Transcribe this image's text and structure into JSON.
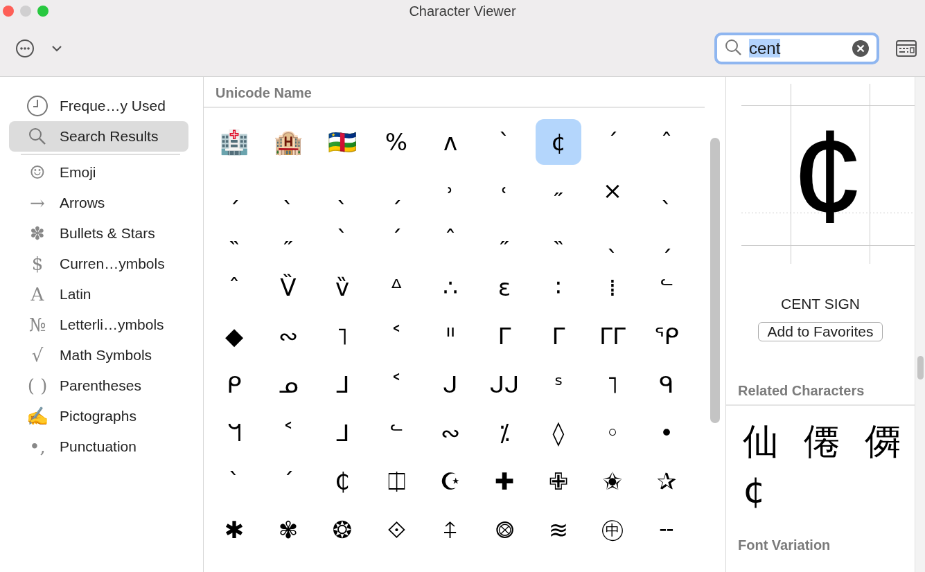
{
  "window": {
    "title": "Character Viewer"
  },
  "search": {
    "value": "cent"
  },
  "sidebar": {
    "items": [
      {
        "label": "Freque…y Used",
        "kind": "clock",
        "selected": false
      },
      {
        "label": "Search Results",
        "kind": "search",
        "selected": true
      },
      {
        "label": "Emoji",
        "kind": "glyph",
        "glyph": "☺",
        "selected": false
      },
      {
        "label": "Arrows",
        "kind": "glyph",
        "glyph": "→",
        "selected": false
      },
      {
        "label": "Bullets & Stars",
        "kind": "glyph",
        "glyph": "✽",
        "selected": false
      },
      {
        "label": "Curren…ymbols",
        "kind": "glyph",
        "glyph": "$",
        "selected": false
      },
      {
        "label": "Latin",
        "kind": "glyph",
        "glyph": "A",
        "selected": false
      },
      {
        "label": "Letterli…ymbols",
        "kind": "glyph",
        "glyph": "№",
        "selected": false
      },
      {
        "label": "Math Symbols",
        "kind": "glyph",
        "glyph": "√",
        "selected": false
      },
      {
        "label": "Parentheses",
        "kind": "glyph",
        "glyph": "( )",
        "selected": false
      },
      {
        "label": "Pictographs",
        "kind": "glyph",
        "glyph": "✍",
        "selected": false
      },
      {
        "label": "Punctuation",
        "kind": "glyph",
        "glyph": "•,",
        "selected": false
      }
    ]
  },
  "grid": {
    "heading": "Unicode Name",
    "cells": [
      {
        "char": "🏥",
        "selected": false
      },
      {
        "char": "🏨",
        "selected": false
      },
      {
        "char": "🇨🇫",
        "selected": false
      },
      {
        "char": "%",
        "selected": false
      },
      {
        "char": "ʌ",
        "selected": false
      },
      {
        "char": "ˋ",
        "selected": false
      },
      {
        "char": "¢",
        "selected": true
      },
      {
        "char": "ˊ",
        "selected": false
      },
      {
        "char": "ˆ",
        "selected": false
      },
      {
        "char": "ˏ",
        "selected": false
      },
      {
        "char": "ˎ",
        "selected": false
      },
      {
        "char": "ˎ",
        "selected": false
      },
      {
        "char": "ˏ",
        "selected": false
      },
      {
        "char": "˒",
        "selected": false
      },
      {
        "char": "˓",
        "selected": false
      },
      {
        "char": "˶",
        "selected": false
      },
      {
        "char": "×",
        "selected": false
      },
      {
        "char": "ˎ",
        "selected": false
      },
      {
        "char": "˵",
        "selected": false
      },
      {
        "char": "˶",
        "selected": false
      },
      {
        "char": "ˋ",
        "selected": false
      },
      {
        "char": "ˊ",
        "selected": false
      },
      {
        "char": "ˆ",
        "selected": false
      },
      {
        "char": "˶",
        "selected": false
      },
      {
        "char": "˵",
        "selected": false
      },
      {
        "char": "ˎ",
        "selected": false
      },
      {
        "char": "ˏ",
        "selected": false
      },
      {
        "char": "ˆ",
        "selected": false
      },
      {
        "char": "V̏",
        "selected": false
      },
      {
        "char": "v̏",
        "selected": false
      },
      {
        "char": "ᐞ",
        "selected": false
      },
      {
        "char": "∴",
        "selected": false
      },
      {
        "char": "ε",
        "selected": false
      },
      {
        "char": "∶",
        "selected": false
      },
      {
        "char": "⁞",
        "selected": false
      },
      {
        "char": "ᓪ",
        "selected": false
      },
      {
        "char": "◆",
        "selected": false
      },
      {
        "char": "∾",
        "selected": false
      },
      {
        "char": "˥",
        "selected": false
      },
      {
        "char": "˂",
        "selected": false
      },
      {
        "char": "ᐦ",
        "selected": false
      },
      {
        "char": "ᒥ",
        "selected": false
      },
      {
        "char": "ᒥ",
        "selected": false
      },
      {
        "char": "ᒥᒥ",
        "selected": false
      },
      {
        "char": "ᕿ",
        "selected": false
      },
      {
        "char": "ᑭ",
        "selected": false
      },
      {
        "char": "ᓄ",
        "selected": false
      },
      {
        "char": "ᒧ",
        "selected": false
      },
      {
        "char": "˂",
        "selected": false
      },
      {
        "char": "ᒍ",
        "selected": false
      },
      {
        "char": "ᒍᒍ",
        "selected": false
      },
      {
        "char": "ˢ",
        "selected": false
      },
      {
        "char": "˥",
        "selected": false
      },
      {
        "char": "ᑫ",
        "selected": false
      },
      {
        "char": "ᖻ",
        "selected": false
      },
      {
        "char": "˂",
        "selected": false
      },
      {
        "char": "ᒧ",
        "selected": false
      },
      {
        "char": "ᓪ",
        "selected": false
      },
      {
        "char": "∾",
        "selected": false
      },
      {
        "char": "⁒",
        "selected": false
      },
      {
        "char": "◊",
        "selected": false
      },
      {
        "char": "◦",
        "selected": false
      },
      {
        "char": "•",
        "selected": false
      },
      {
        "char": "ˋ",
        "selected": false
      },
      {
        "char": "ˊ",
        "selected": false
      },
      {
        "char": "₵",
        "selected": false
      },
      {
        "char": "⎅",
        "selected": false
      },
      {
        "char": "☪",
        "selected": false
      },
      {
        "char": "✚",
        "selected": false
      },
      {
        "char": "✙",
        "selected": false
      },
      {
        "char": "✬",
        "selected": false
      },
      {
        "char": "✰",
        "selected": false
      },
      {
        "char": "✱",
        "selected": false
      },
      {
        "char": "✾",
        "selected": false
      },
      {
        "char": "❂",
        "selected": false
      },
      {
        "char": "⟐",
        "selected": false
      },
      {
        "char": "⍏",
        "selected": false
      },
      {
        "char": "⨷",
        "selected": false
      },
      {
        "char": "≋",
        "selected": false
      },
      {
        "char": "㊥",
        "selected": false
      },
      {
        "char": "╌",
        "selected": false
      }
    ]
  },
  "detail": {
    "char": "¢",
    "name": "CENT SIGN",
    "button": "Add to Favorites",
    "related_heading": "Related Characters",
    "related": [
      "仙",
      "僊",
      "僲",
      "¢"
    ],
    "font_heading": "Font Variation"
  }
}
